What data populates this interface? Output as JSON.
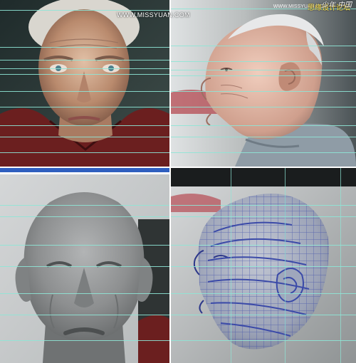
{
  "header": {
    "cn_text": "思缘设计论坛",
    "url": "WWW.MISSYUAN.COM",
    "logo": "少年 中国",
    "small_url": "WWW.MISSYUAN.COM"
  },
  "panels": [
    {
      "id": "photo-front",
      "kind": "photo"
    },
    {
      "id": "photo-profile",
      "kind": "photo"
    },
    {
      "id": "model-front",
      "kind": "3d-render"
    },
    {
      "id": "model-profile",
      "kind": "3d-wireframe"
    }
  ],
  "colors": {
    "guide": "#8ee6d6",
    "header_text": "#ffe34a",
    "wire": "#3b4aa8",
    "clay": "#8d8f90"
  }
}
